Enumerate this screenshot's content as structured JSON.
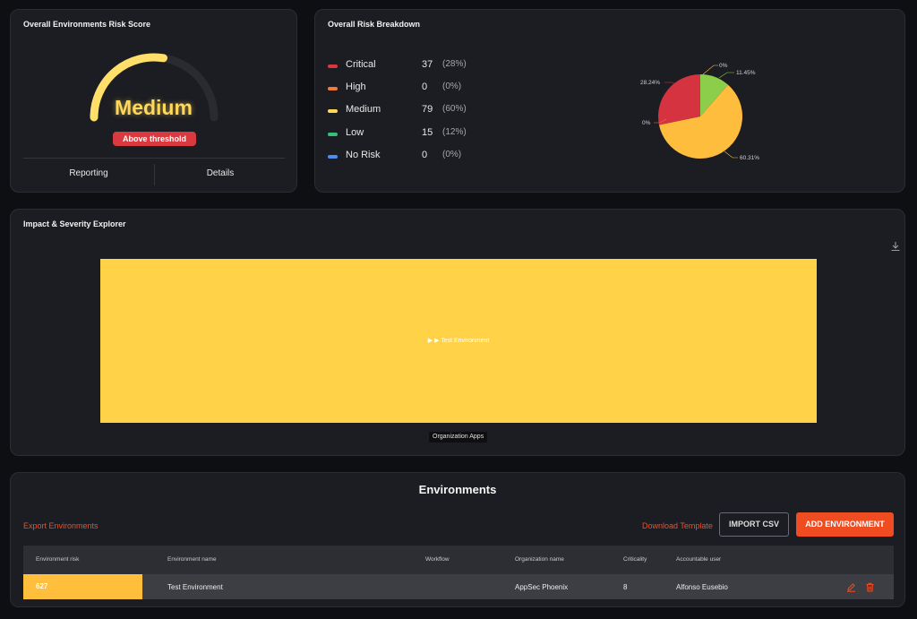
{
  "score_panel": {
    "title": "Overall Environments Risk Score",
    "gauge_level": 0.55,
    "level_label": "Medium",
    "threshold_badge": "Above threshold",
    "tabs": [
      "Reporting",
      "Details"
    ]
  },
  "breakdown": {
    "title": "Overall Risk Breakdown",
    "rows": [
      {
        "name": "Critical",
        "count": "37",
        "pct": "(28%)",
        "color": "#d9383e"
      },
      {
        "name": "High",
        "count": "0",
        "pct": "(0%)",
        "color": "#f07a3a"
      },
      {
        "name": "Medium",
        "count": "79",
        "pct": "(60%)",
        "color": "#ffd75a"
      },
      {
        "name": "Low",
        "count": "15",
        "pct": "(12%)",
        "color": "#37c07a"
      },
      {
        "name": "No Risk",
        "count": "0",
        "pct": "(0%)",
        "color": "#4b8df0"
      }
    ],
    "pie_labels": {
      "critical": "28.24%",
      "high": "0%",
      "medium": "60.31%",
      "low": "11.45%",
      "none": "0%"
    }
  },
  "chart_data": {
    "type": "pie",
    "categories": [
      "Critical",
      "High",
      "Medium",
      "Low",
      "No Risk"
    ],
    "values": [
      28.24,
      0,
      60.31,
      11.45,
      0
    ],
    "colors": [
      "#d4333f",
      "#f07a3a",
      "#ffbd3e",
      "#8ccd4a",
      "#4b8df0"
    ]
  },
  "impact": {
    "title": "Impact & Severity Explorer",
    "treemap_label": "▶ ▶ Test Environment",
    "caption": "Organization Apps",
    "download_icon": "download-icon"
  },
  "environments": {
    "title": "Environments",
    "export_link": "Export Environments",
    "download_template": "Download Template",
    "import_csv": "IMPORT CSV",
    "add_environment": "ADD ENVIRONMENT",
    "columns": [
      "Environment risk",
      "Environment name",
      "Workflow",
      "Organization name",
      "Criticality",
      "Accountable user"
    ],
    "rows": [
      {
        "risk": "627",
        "name": "Test Environment",
        "workflow": "",
        "org": "AppSec Phoenix",
        "criticality": "8",
        "user": "Alfonso Eusebio"
      }
    ],
    "risk_color": "#ffbe3b",
    "accent": "#ef4c22"
  }
}
